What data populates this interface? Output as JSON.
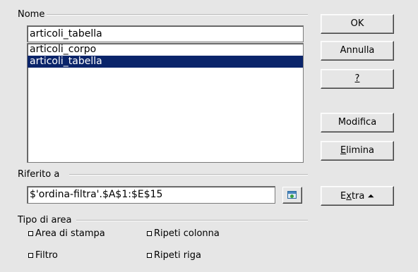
{
  "name_section": {
    "label": "Nome",
    "input_value": "articoli_tabella",
    "items": [
      {
        "label": "articoli_corpo",
        "selected": false
      },
      {
        "label": "articoli_tabella",
        "selected": true
      }
    ]
  },
  "ref_section": {
    "label": "Riferito a",
    "input_value": "$'ordina-filtra'.$A$1:$E$15",
    "shrink_icon": "range-select-icon"
  },
  "area_section": {
    "label": "Tipo di area",
    "options": [
      {
        "label": "Area di stampa",
        "checked": false
      },
      {
        "label": "Ripeti colonna",
        "checked": false
      },
      {
        "label": "Filtro",
        "checked": false
      },
      {
        "label": "Ripeti riga",
        "checked": false
      }
    ]
  },
  "buttons": {
    "ok": "OK",
    "cancel": "Annulla",
    "help": "?",
    "modify": "Modifica",
    "delete_prefix": "",
    "delete_mnemonic": "E",
    "delete_rest": "limina",
    "extra_prefix": "E",
    "extra_mnemonic": "x",
    "extra_rest": "tra",
    "extra_icon": "double-chevron-up-icon"
  },
  "colors": {
    "selection": "#0a246a",
    "dialog_bg": "#e6e6e6"
  }
}
